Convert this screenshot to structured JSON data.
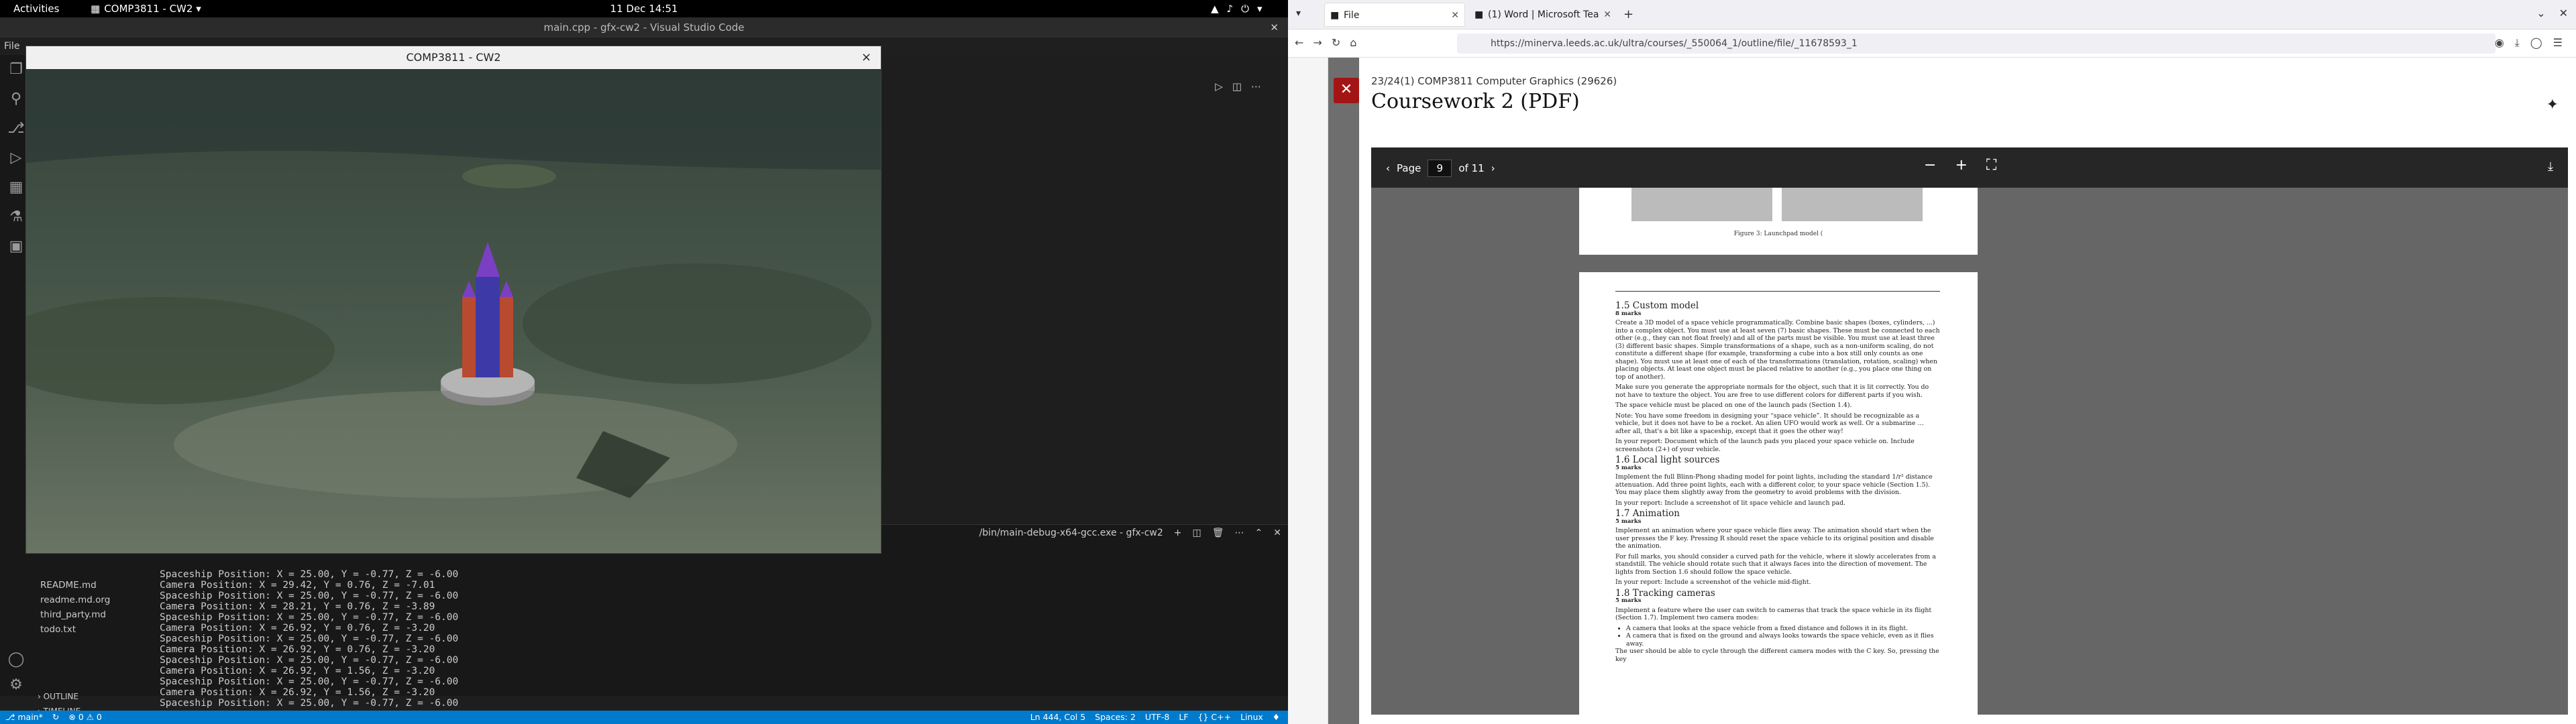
{
  "topbar": {
    "activities": "Activities",
    "app": "COMP3811 - CW2 ▾",
    "clock": "11 Dec  14:51"
  },
  "vscode": {
    "title": "main.cpp - gfx-cw2 - Visual Studio Code",
    "menu_first": "File",
    "terminal_tab": "/bin/main-debug-x64-gcc.exe - gfx-cw2",
    "files": [
      "README.md",
      "readme.md.org",
      "third_party.md",
      "todo.txt"
    ],
    "outline": [
      "OUTLINE",
      "TIMELINE"
    ],
    "terminal_lines": [
      "Spaceship Position: X = 25.00, Y = -0.77, Z = -6.00",
      "Camera Position: X = 29.42, Y = 0.76, Z = -7.01",
      "Spaceship Position: X = 25.00, Y = -0.77, Z = -6.00",
      "Camera Position: X = 28.21, Y = 0.76, Z = -3.89",
      "Spaceship Position: X = 25.00, Y = -0.77, Z = -6.00",
      "Camera Position: X = 26.92, Y = 0.76, Z = -3.20",
      "Spaceship Position: X = 25.00, Y = -0.77, Z = -6.00",
      "Camera Position: X = 26.92, Y = 0.76, Z = -3.20",
      "Spaceship Position: X = 25.00, Y = -0.77, Z = -6.00",
      "Camera Position: X = 26.92, Y = 1.56, Z = -3.20",
      "Spaceship Position: X = 25.00, Y = -0.77, Z = -6.00",
      "Camera Position: X = 26.92, Y = 1.56, Z = -3.20",
      "Spaceship Position: X = 25.00, Y = -0.77, Z = -6.00"
    ],
    "status": {
      "branch": "⎇ main*",
      "sync": "↻",
      "problems": "⊗ 0 ⚠ 0",
      "ln": "Ln 444, Col 5",
      "spaces": "Spaces: 2",
      "enc": "UTF-8",
      "eol": "LF",
      "lang": "{} C++",
      "os": "Linux"
    }
  },
  "glwindow": {
    "title": "COMP3811 - CW2",
    "close": "×"
  },
  "firefox": {
    "tabs": [
      {
        "label": "File",
        "icon": "■"
      },
      {
        "label": "(1) Word | Microsoft Tea",
        "icon": "■"
      }
    ],
    "url": "https://minerva.leeds.ac.uk/ultra/courses/_550064_1/outline/file/_11678593_1",
    "course": "23/24(1) COMP3811 Computer Graphics (29626)",
    "doc_title": "Coursework 2 (PDF)",
    "pdf": {
      "page_label": "Page",
      "page": "9",
      "of": "of 11"
    },
    "prev_caption": "Figure 3: Launchpad model (",
    "page": {
      "s15_title": "1.5   Custom model",
      "s15_marks": "8 marks",
      "s15_p1": "Create a 3D model of a space vehicle programmatically. Combine basic shapes (boxes, cylinders, ...) into a complex object. You must use at least seven (7) basic shapes. These must be connected to each other (e.g., they can not float freely) and all of the parts must be visible. You must use at least three (3) different basic shapes. Simple transformations of a shape, such as a non-uniform scaling, do not constitute a different shape (for example, transforming a cube into a box still only counts as one shape). You must use at least one of each of the transformations (translation, rotation, scaling) when placing objects. At least one object must be placed relative to another (e.g., you place one thing on top of another).",
      "s15_p2": "Make sure you generate the appropriate normals for the object, such that it is lit correctly. You do not have to texture the object. You are free to use different colors for different parts if you wish.",
      "s15_p3": "The space vehicle must be placed on one of the launch pads (Section 1.4).",
      "s15_p4": "Note: You have some freedom in designing your “space vehicle”. It should be recognizable as a vehicle, but it does not have to be a rocket. An alien UFO would work as well. Or a submarine … after all, that's a bit like a spaceship, except that it goes the other way!",
      "s15_report": "In your report: Document which of the launch pads you placed your space vehicle on. Include screenshots (2+) of your vehicle.",
      "s16_title": "1.6   Local light sources",
      "s16_marks": "5 marks",
      "s16_p1": "Implement the full Blinn-Phong shading model for point lights, including the standard 1/r² distance attenuation. Add three point lights, each with a different color, to your space vehicle (Section 1.5). You may place them slightly away from the geometry to avoid problems with the division.",
      "s16_report": "In your report: Include a screenshot of lit space vehicle and launch pad.",
      "s17_title": "1.7   Animation",
      "s17_marks": "5 marks",
      "s17_p1": "Implement an animation where your space vehicle flies away. The animation should start when the user presses the F key. Pressing R should reset the space vehicle to its original position and disable the animation.",
      "s17_p2": "For full marks, you should consider a curved path for the vehicle, where it slowly accelerates from a standstill. The vehicle should rotate such that it always faces into the direction of movement. The lights from Section 1.6 should follow the space vehicle.",
      "s17_report": "In your report: Include a screenshot of the vehicle mid-flight.",
      "s18_title": "1.8   Tracking cameras",
      "s18_marks": "5 marks",
      "s18_p1": "Implement a feature where the user can switch to cameras that track the space vehicle in its flight (Section 1.7). Implement two camera modes:",
      "s18_li1": "A camera that looks at the space vehicle from a fixed distance and follows it in its flight.",
      "s18_li2": "A camera that is fixed on the ground and always looks towards the space vehicle, even as it flies away.",
      "s18_p2": "The user should be able to cycle through the different camera modes with the C key. So, pressing the key"
    }
  }
}
